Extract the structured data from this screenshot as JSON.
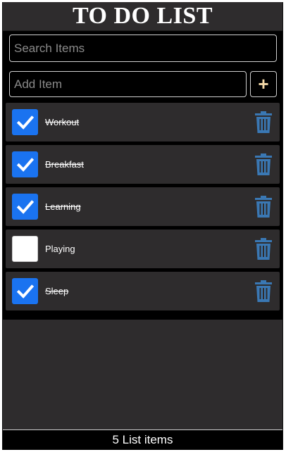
{
  "header": {
    "title": "TO DO LIST"
  },
  "search": {
    "placeholder": "Search Items",
    "value": ""
  },
  "add": {
    "placeholder": "Add Item",
    "value": "",
    "button_label": "+"
  },
  "items": [
    {
      "label": "Workout",
      "checked": true
    },
    {
      "label": "Breakfast",
      "checked": true
    },
    {
      "label": "Learning",
      "checked": true
    },
    {
      "label": "Playing",
      "checked": false
    },
    {
      "label": "Sleep",
      "checked": true
    }
  ],
  "footer": {
    "count_text": "5 List items"
  },
  "icons": {
    "check": "check-icon",
    "delete": "trash-icon",
    "add": "plus-icon"
  },
  "colors": {
    "checkbox_checked": "#1a73f0",
    "trash": "#3a78b4",
    "plus": "#f4d9a8"
  }
}
